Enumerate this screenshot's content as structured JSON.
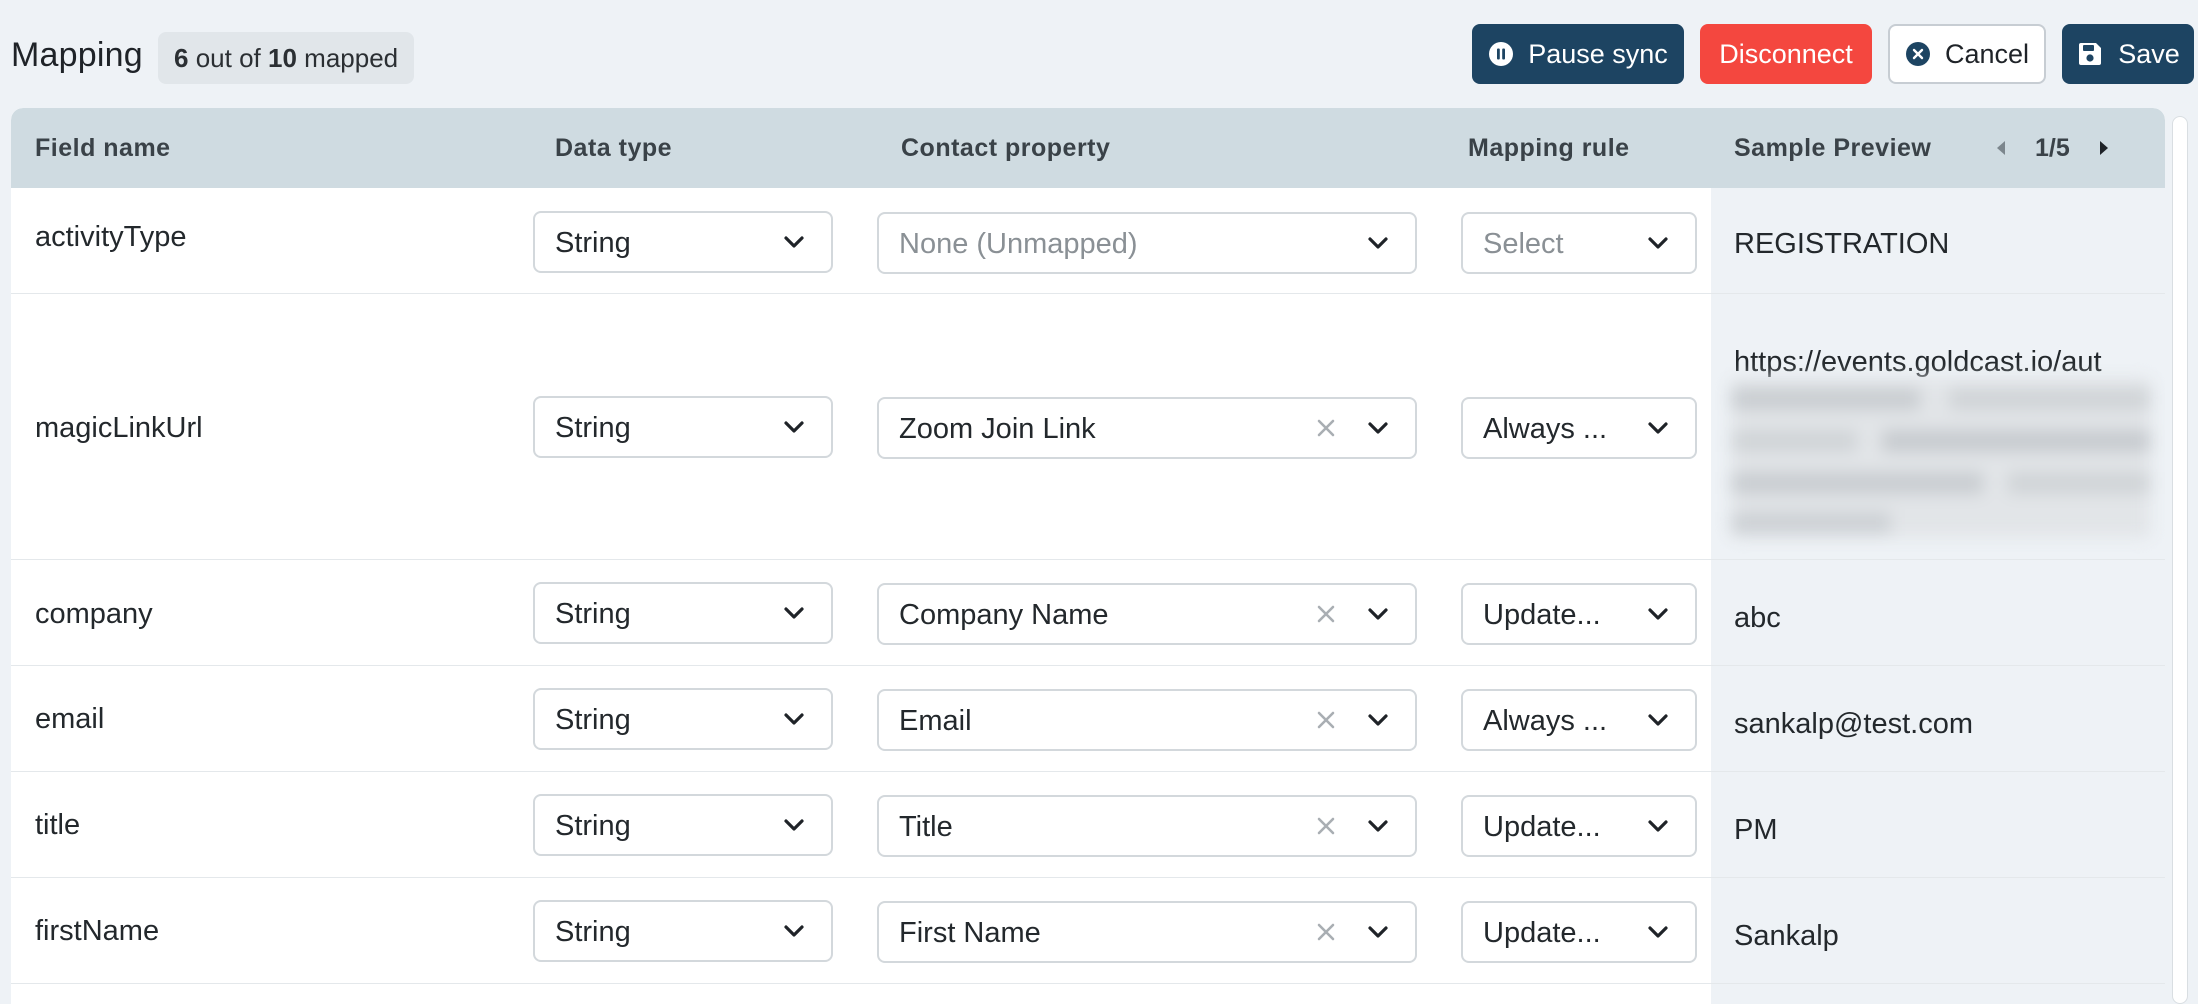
{
  "header": {
    "title": "Mapping",
    "mapped_count": "6",
    "out_of_text": "out of",
    "total_count": "10",
    "mapped_suffix": "mapped",
    "pause_label": "Pause sync",
    "disconnect_label": "Disconnect",
    "cancel_label": "Cancel",
    "save_label": "Save"
  },
  "table": {
    "columns": {
      "field_name": "Field name",
      "data_type": "Data type",
      "contact_property": "Contact property",
      "mapping_rule": "Mapping rule",
      "sample_preview": "Sample Preview"
    },
    "pager": {
      "text": "1/5"
    },
    "rows": [
      {
        "field": "activityType",
        "data_type": "String",
        "contact_property": "None (Unmapped)",
        "mapping_rule": "Select",
        "preview": "REGISTRATION"
      },
      {
        "field": "magicLinkUrl",
        "data_type": "String",
        "contact_property": "Zoom Join Link",
        "mapping_rule": "Always ...",
        "preview": "https://events.goldcast.io/aut"
      },
      {
        "field": "company",
        "data_type": "String",
        "contact_property": "Company Name",
        "mapping_rule": "Update...",
        "preview": "abc"
      },
      {
        "field": "email",
        "data_type": "String",
        "contact_property": "Email",
        "mapping_rule": "Always ...",
        "preview": "sankalp@test.com"
      },
      {
        "field": "title",
        "data_type": "String",
        "contact_property": "Title",
        "mapping_rule": "Update...",
        "preview": "PM"
      },
      {
        "field": "firstName",
        "data_type": "String",
        "contact_property": "First Name",
        "mapping_rule": "Update...",
        "preview": "Sankalp"
      }
    ]
  },
  "colors": {
    "primary": "#1d4462",
    "danger": "#f4473f",
    "header_bg": "#cfdbe1",
    "page_bg": "#eef2f6"
  },
  "icons": {
    "pause": "pause-circle-icon",
    "cancel": "x-circle-icon",
    "save": "floppy-disk-icon",
    "dropdown": "chevron-down-icon",
    "clear": "clear-x-icon",
    "pager_prev": "caret-left-icon",
    "pager_next": "caret-right-icon"
  }
}
